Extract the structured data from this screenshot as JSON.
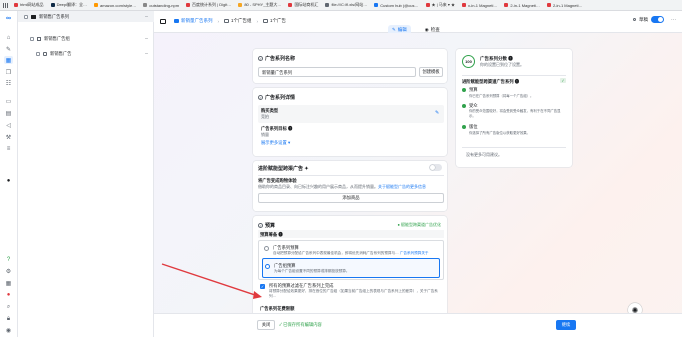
{
  "bookmarks": [
    "html网站成品",
    "Deepl翻译：全…",
    "amazon.com/style…",
    "outstanding-npm",
    "百度统计系列 | Digit…",
    "80 - SPHY_主题大…",
    "国际站商机汇",
    "file:///C:/fl.xls/网站…",
    "Custom hub (@cus…",
    "★ | 马来 ▾ ★",
    "x-in-1 Magneti…",
    "2-in-1 Magneti…",
    "2-in-1 Magneti…"
  ],
  "tree": {
    "campaign": "新销售广告系列",
    "adset": "新销售广告组",
    "ad": "新销售广告"
  },
  "header": {
    "crumbs": [
      "新销量广告系列",
      "1个广告组",
      "1个广告"
    ],
    "status_label": "草稿",
    "edit_tab": "编辑",
    "review_tab": "检查"
  },
  "name_card": {
    "title": "广告系列名称",
    "value": "新销量广告系列",
    "template_button": "创建模板"
  },
  "details_card": {
    "title": "广告系列详情",
    "purchase_type_label": "购买类型",
    "purchase_type_value": "竞拍",
    "objective_label": "广告系列目标",
    "objective_value": "销量",
    "more_link": "展示更多设置 ▾"
  },
  "special_card": {
    "title": "进阶赋能型跨渠广告 ✦",
    "sub_title": "将广告变成购物体验",
    "sub_text": "借助你的商品目录、向已标注兴趣的用户展示商品，从而提升销量。",
    "sub_link": "关于赋能型广告的更多信息",
    "add_button": "添加商品"
  },
  "budget_card": {
    "title": "预算",
    "badge": "● 赋能型跨渠道广告优化",
    "section_label": "预算筹备",
    "opt1_title": "广告系列预算",
    "opt1_desc": "自动把预算分配给广告系列中表现最佳机会，即将优先消耗广告系列的预算与…",
    "opt1_link": "广告系列预算关于",
    "opt2_title": "广告组预算",
    "opt2_desc": "为每个广告组设置不同的预算或排期投放预算。",
    "check_title": "所有的预算过滤在广告系列上完成",
    "check_desc": "将预算分配给效果更好、排在首位的广告组（如果当前广告组上的表现与广告系列上的差异），关于广告系列…",
    "bottom_label": "广告系列花费限额"
  },
  "summary_card": {
    "score": "100",
    "title": "广告系列分数 ❶",
    "subtitle": "你的设置已到位了设置。",
    "adv_title": "进阶赋能型跨渠道广告系列 ❶",
    "items": [
      {
        "title": "预算",
        "desc": "你已在广告系列预算（将每一个广告组）。"
      },
      {
        "title": "受众",
        "desc": "你的受众范围较好，将会受到受众触发，有利于在不同广告显示。"
      },
      {
        "title": "版位",
        "desc": "你选择了所有广告版位以获取更好效果。"
      }
    ],
    "footer": "没有更多可用建议。"
  },
  "footer": {
    "close_button": "关闭",
    "saved_text": "✓ 已保存所有编辑内容",
    "publish_button": "继续"
  },
  "colors": {
    "accent": "#1877f2",
    "success": "#31a24c",
    "arrow": "#e0393e"
  }
}
